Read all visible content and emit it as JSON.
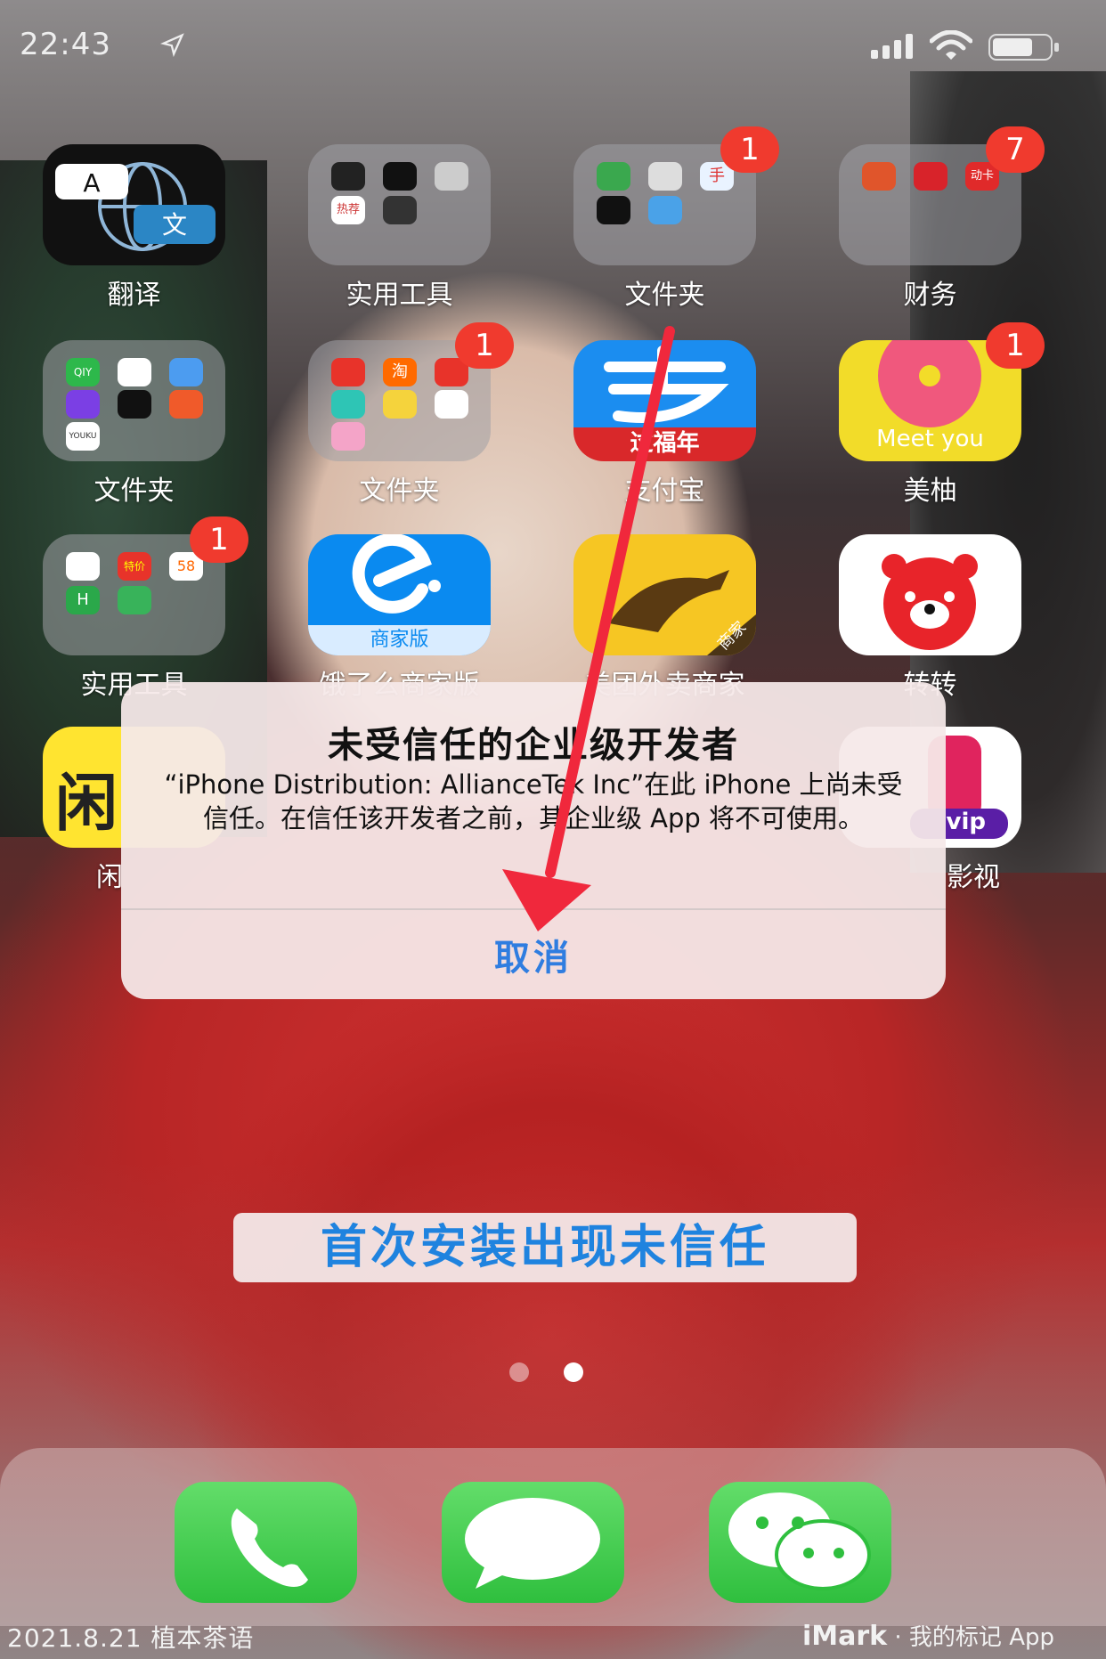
{
  "status_bar": {
    "time": "22:43"
  },
  "apps": [
    {
      "label": "翻译"
    },
    {
      "label": "实用工具",
      "mini_texts": [
        "",
        "",
        "",
        "",
        "热荐",
        ""
      ]
    },
    {
      "label": "文件夹",
      "badge": "1",
      "mini_texts": [
        "",
        "",
        "手"
      ]
    },
    {
      "label": "财务",
      "badge": "7",
      "mini_texts": [
        "",
        "",
        "动卡"
      ]
    },
    {
      "label": "文件夹",
      "mini_texts": [
        "QIY",
        "",
        "",
        "",
        "",
        "",
        "YOUKU"
      ]
    },
    {
      "label": "文件夹",
      "badge": "1",
      "mini_texts": [
        "",
        "淘",
        "",
        "",
        "",
        "",
        ""
      ]
    },
    {
      "label": "支付宝",
      "overlay_text": "过福年"
    },
    {
      "label": "美柚",
      "badge": "1",
      "overlay_text": "Meet you"
    },
    {
      "label": "实用工具",
      "badge": "1",
      "mini_texts": [
        "",
        "特价",
        "58",
        "H",
        ""
      ]
    },
    {
      "label": "饿了么商家版",
      "overlay_text": "商家版"
    },
    {
      "label": "美团外卖商家",
      "overlay_text": "商家"
    },
    {
      "label": "转转"
    },
    {
      "label": "闲",
      "overlay_text": "闲"
    },
    {
      "label": "影视",
      "overlay_text": "vip"
    }
  ],
  "alert": {
    "title": "未受信任的企业级开发者",
    "message": "“iPhone Distribution: AllianceTek Inc”在此 iPhone 上尚未受信任。在信任该开发者之前，其企业级 App 将不可使用。",
    "cancel_label": "取消"
  },
  "caption": "首次安装出现未信任",
  "footer": {
    "left": "2021.8.21 植本茶语",
    "brand": "iMark",
    "right": "· 我的标记 App"
  },
  "colors": {
    "badge": "#f03a2e",
    "alert_button": "#2f7de0",
    "caption_text": "#1f83df",
    "arrow": "#f0283c",
    "dock_green": "#2fbf3e"
  }
}
